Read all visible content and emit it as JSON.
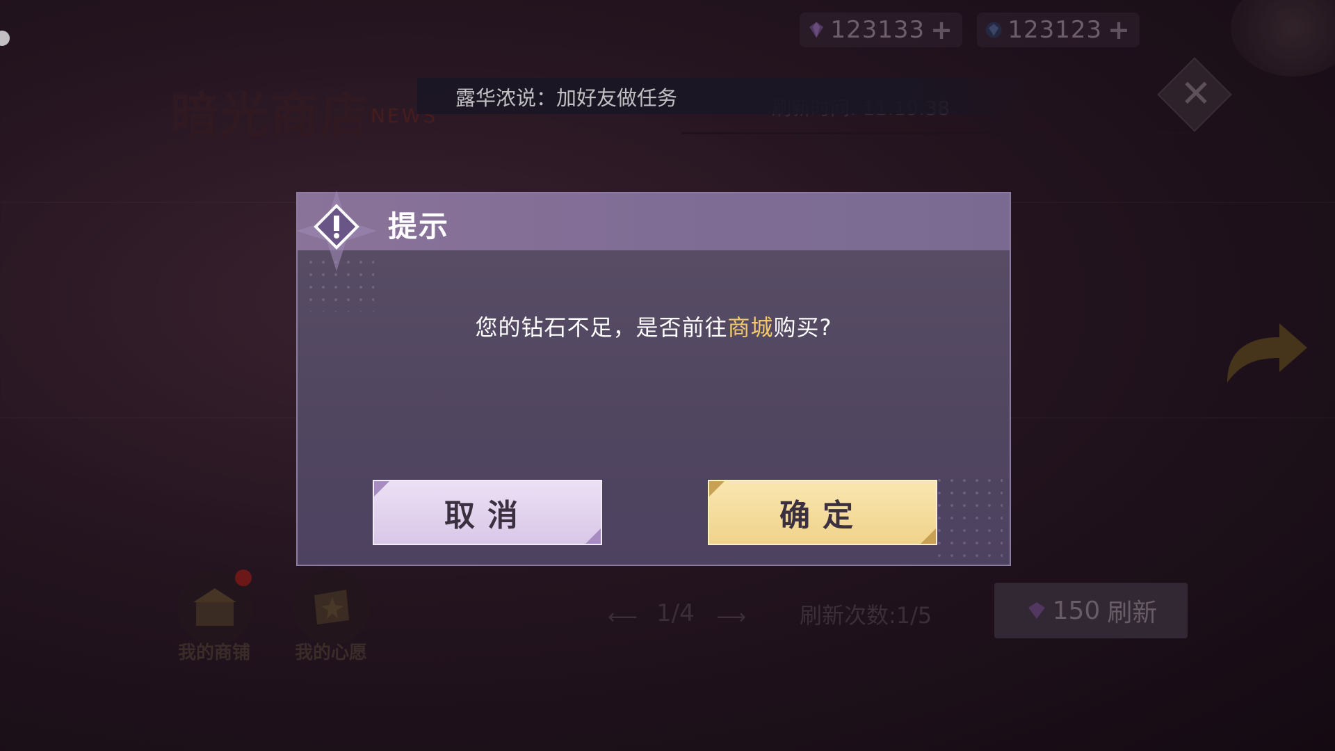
{
  "currency": [
    {
      "icon": "purple-diamond-icon",
      "amount": "123133"
    },
    {
      "icon": "blue-diamond-icon",
      "amount": "123123"
    }
  ],
  "background": {
    "shop_title": "暗光商店",
    "shop_title_en": "NEWS",
    "refresh_time": "刷新时间: 11:19:38",
    "shortcuts": [
      {
        "label": "我的商铺",
        "icon": "shop-icon"
      },
      {
        "label": "我的心愿",
        "icon": "wish-scroll-icon"
      }
    ],
    "page_indicator": "1/4",
    "refresh_count": "刷新次数:1/5",
    "refresh_button": {
      "cost": "150",
      "label": "刷新"
    }
  },
  "ticker": {
    "text": "露华浓说：加好友做任务"
  },
  "dialog": {
    "title": "提示",
    "message_prefix": "您的钻石不足，是否前往",
    "message_highlight": "商城",
    "message_suffix": "购买?",
    "cancel_label": "取消",
    "confirm_label": "确定"
  },
  "colors": {
    "highlight": "#f2c96a",
    "confirm": "#f0d38c",
    "cancel": "#d9c7e8"
  }
}
